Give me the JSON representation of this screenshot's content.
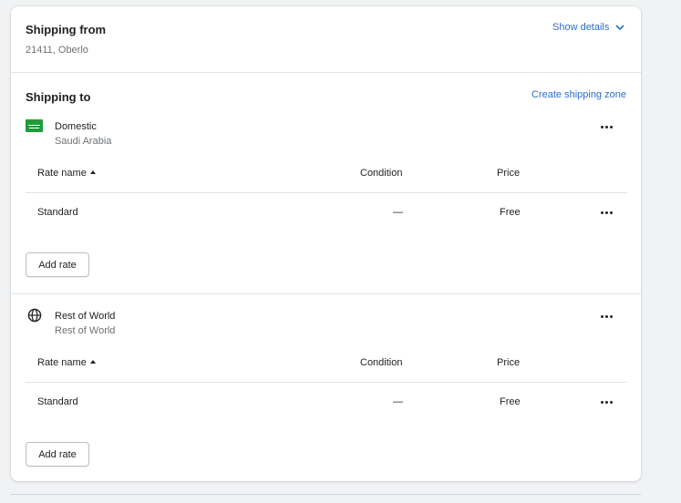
{
  "shipping_from": {
    "title": "Shipping from",
    "address": "21411, Oberlo",
    "show_details": "Show details"
  },
  "shipping_to": {
    "title": "Shipping to",
    "create_zone": "Create shipping zone"
  },
  "table_headers": {
    "rate_name": "Rate name",
    "condition": "Condition",
    "price": "Price"
  },
  "zones": [
    {
      "name": "Domestic",
      "region": "Saudi Arabia",
      "icon": "saudi-flag-icon",
      "rates": [
        {
          "name": "Standard",
          "condition": "—",
          "price": "Free"
        }
      ],
      "add_rate": "Add rate"
    },
    {
      "name": "Rest of World",
      "region": "Rest of World",
      "icon": "globe-icon",
      "rates": [
        {
          "name": "Standard",
          "condition": "—",
          "price": "Free"
        }
      ],
      "add_rate": "Add rate"
    }
  ],
  "colors": {
    "link": "#2c6ecb",
    "flag_green": "#1c9d3a",
    "border": "#e1e3e5"
  }
}
